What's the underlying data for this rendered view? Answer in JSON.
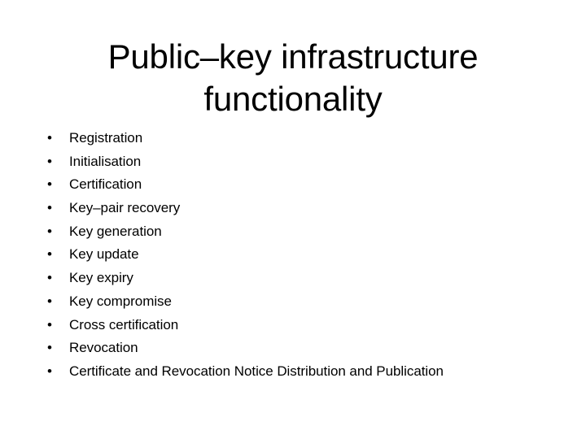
{
  "slide": {
    "title_lines": [
      "Public–key infrastructure",
      "functionality"
    ],
    "bullet_marker": "•",
    "bullets": [
      "Registration",
      "Initialisation",
      "Certification",
      "Key–pair recovery",
      "Key generation",
      "Key update",
      "Key expiry",
      "Key compromise",
      "Cross certification",
      "Revocation",
      "Certificate and Revocation Notice Distribution and Publication"
    ],
    "colors": {
      "background": "#ffffff",
      "text": "#000000"
    }
  }
}
